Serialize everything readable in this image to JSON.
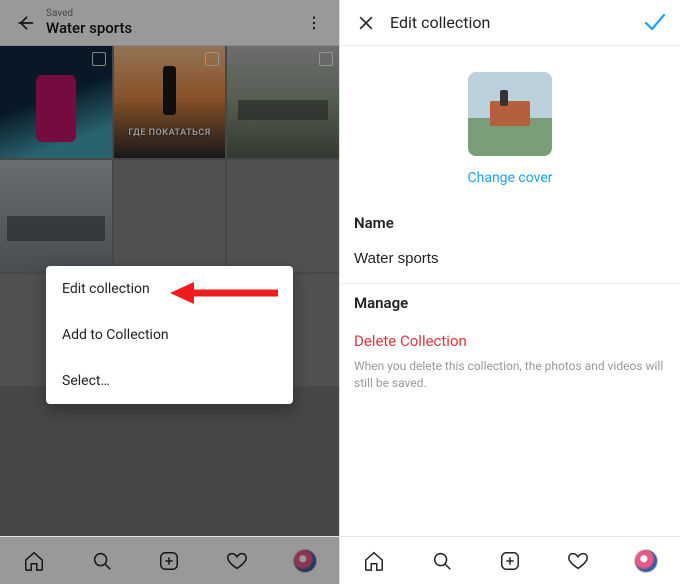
{
  "left": {
    "saved_label": "Saved",
    "collection_title": "Water sports",
    "thumb2_caption": "ГДЕ ПОКАТАТЬСЯ",
    "menu": {
      "edit": "Edit collection",
      "add": "Add to Collection",
      "select": "Select…"
    }
  },
  "right": {
    "header_title": "Edit collection",
    "change_cover": "Change cover",
    "name_label": "Name",
    "name_value": "Water sports",
    "manage_label": "Manage",
    "delete_label": "Delete Collection",
    "delete_help": "When you delete this collection, the photos and videos will still be saved."
  },
  "colors": {
    "accent": "#1da1f2",
    "danger": "#d9363e"
  }
}
